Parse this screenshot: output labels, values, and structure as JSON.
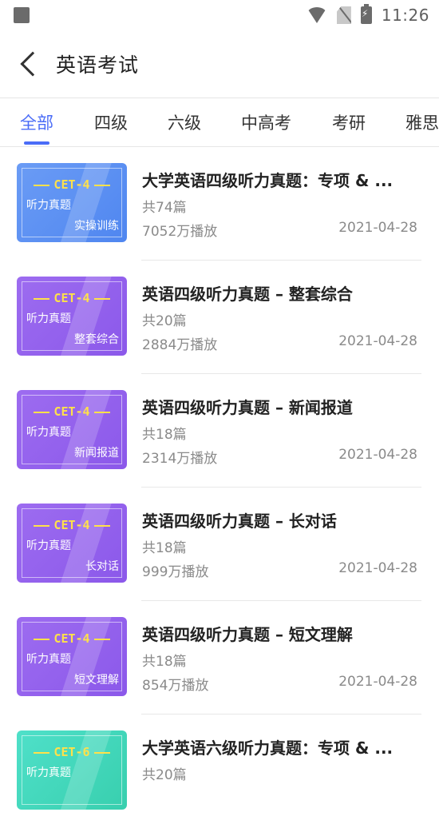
{
  "status": {
    "time": "11:26"
  },
  "header": {
    "title": "英语考试"
  },
  "tabs": [
    {
      "label": "全部",
      "active": true
    },
    {
      "label": "四级"
    },
    {
      "label": "六级"
    },
    {
      "label": "中高考"
    },
    {
      "label": "考研"
    },
    {
      "label": "雅思"
    }
  ],
  "items": [
    {
      "title": "大学英语四级听力真题：专项 & ...",
      "count": "共74篇",
      "plays": "7052万播放",
      "date": "2021-04-28",
      "thumb": {
        "badge": "CET-4",
        "line1": "听力真题",
        "line2": "实操训练",
        "color": "blue"
      }
    },
    {
      "title": "英语四级听力真题 – 整套综合",
      "count": "共20篇",
      "plays": "2884万播放",
      "date": "2021-04-28",
      "thumb": {
        "badge": "CET-4",
        "line1": "听力真题",
        "line2": "整套综合",
        "color": "purple"
      }
    },
    {
      "title": "英语四级听力真题 – 新闻报道",
      "count": "共18篇",
      "plays": "2314万播放",
      "date": "2021-04-28",
      "thumb": {
        "badge": "CET-4",
        "line1": "听力真题",
        "line2": "新闻报道",
        "color": "purple"
      }
    },
    {
      "title": "英语四级听力真题 – 长对话",
      "count": "共18篇",
      "plays": "999万播放",
      "date": "2021-04-28",
      "thumb": {
        "badge": "CET-4",
        "line1": "听力真题",
        "line2": "长对话",
        "color": "purple"
      }
    },
    {
      "title": "英语四级听力真题 – 短文理解",
      "count": "共18篇",
      "plays": "854万播放",
      "date": "2021-04-28",
      "thumb": {
        "badge": "CET-4",
        "line1": "听力真题",
        "line2": "短文理解",
        "color": "purple"
      }
    },
    {
      "title": "大学英语六级听力真题：专项 & ...",
      "count": "共20篇",
      "plays": "",
      "date": "",
      "thumb": {
        "badge": "CET-6",
        "line1": "听力真题",
        "line2": "",
        "color": "teal"
      }
    }
  ]
}
